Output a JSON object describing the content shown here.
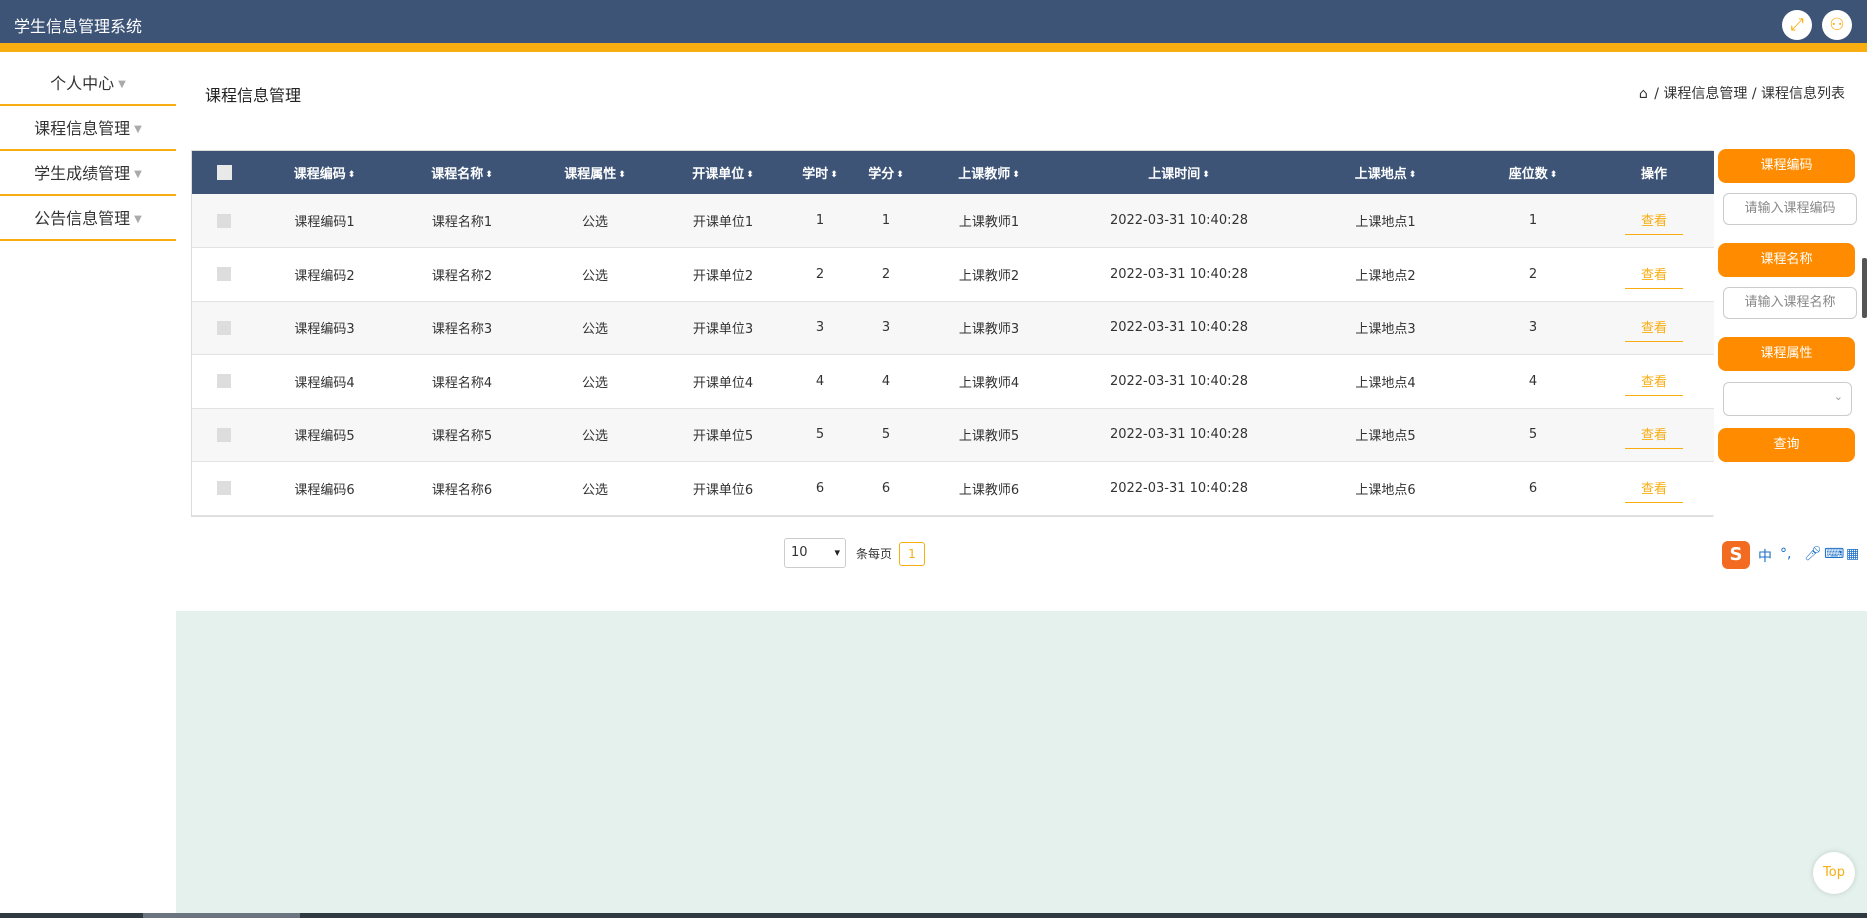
{
  "app": {
    "title": "学生信息管理系统"
  },
  "topbar": {
    "fullscreen_icon": "expand-icon",
    "user_icon": "user-icon"
  },
  "sidebar": {
    "items": [
      {
        "label": "个人中心"
      },
      {
        "label": "课程信息管理"
      },
      {
        "label": "学生成绩管理"
      },
      {
        "label": "公告信息管理"
      }
    ]
  },
  "page": {
    "title": "课程信息管理",
    "breadcrumb": {
      "level1": "课程信息管理",
      "level2": "课程信息列表",
      "separator": "/"
    }
  },
  "table": {
    "headers": [
      "课程编码",
      "课程名称",
      "课程属性",
      "开课单位",
      "学时",
      "学分",
      "上课教师",
      "上课时间",
      "上课地点",
      "座位数",
      "操作"
    ],
    "sortable": [
      true,
      true,
      true,
      true,
      true,
      true,
      true,
      true,
      true,
      true,
      false
    ],
    "rows": [
      {
        "code": "课程编码1",
        "name": "课程名称1",
        "attr": "公选",
        "unit": "开课单位1",
        "hours": "1",
        "credits": "1",
        "teacher": "上课教师1",
        "time": "2022-03-31 10:40:28",
        "place": "上课地点1",
        "seats": "1",
        "action": "查看"
      },
      {
        "code": "课程编码2",
        "name": "课程名称2",
        "attr": "公选",
        "unit": "开课单位2",
        "hours": "2",
        "credits": "2",
        "teacher": "上课教师2",
        "time": "2022-03-31 10:40:28",
        "place": "上课地点2",
        "seats": "2",
        "action": "查看"
      },
      {
        "code": "课程编码3",
        "name": "课程名称3",
        "attr": "公选",
        "unit": "开课单位3",
        "hours": "3",
        "credits": "3",
        "teacher": "上课教师3",
        "time": "2022-03-31 10:40:28",
        "place": "上课地点3",
        "seats": "3",
        "action": "查看"
      },
      {
        "code": "课程编码4",
        "name": "课程名称4",
        "attr": "公选",
        "unit": "开课单位4",
        "hours": "4",
        "credits": "4",
        "teacher": "上课教师4",
        "time": "2022-03-31 10:40:28",
        "place": "上课地点4",
        "seats": "4",
        "action": "查看"
      },
      {
        "code": "课程编码5",
        "name": "课程名称5",
        "attr": "公选",
        "unit": "开课单位5",
        "hours": "5",
        "credits": "5",
        "teacher": "上课教师5",
        "time": "2022-03-31 10:40:28",
        "place": "上课地点5",
        "seats": "5",
        "action": "查看"
      },
      {
        "code": "课程编码6",
        "name": "课程名称6",
        "attr": "公选",
        "unit": "开课单位6",
        "hours": "6",
        "credits": "6",
        "teacher": "上课教师6",
        "time": "2022-03-31 10:40:28",
        "place": "上课地点6",
        "seats": "6",
        "action": "查看"
      }
    ]
  },
  "search": {
    "code_label": "课程编码",
    "code_placeholder": "请输入课程编码",
    "name_label": "课程名称",
    "name_placeholder": "请输入课程名称",
    "attr_label": "课程属性",
    "attr_value": "",
    "query_label": "查询"
  },
  "pagination": {
    "page_size": "10",
    "per_page_label": "条每页",
    "current_page": "1"
  },
  "ime": {
    "labels": [
      "中",
      "°,"
    ]
  },
  "misc": {
    "top_label": "Top"
  },
  "colors": {
    "header_bg": "#3d5477",
    "accent": "#f8ad10",
    "button": "#ff8c00"
  }
}
